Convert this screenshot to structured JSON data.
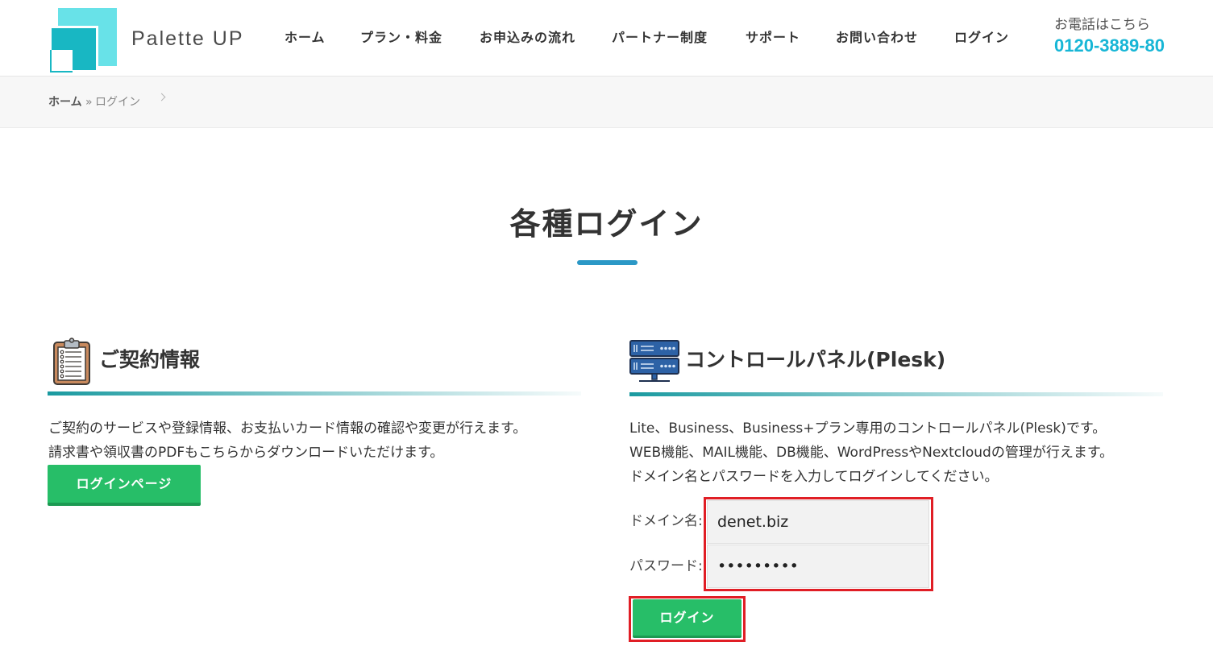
{
  "header": {
    "logo_icon": "palette-up-logo-icon",
    "logo_text": "Palette UP",
    "nav": [
      "ホーム",
      "プラン・料金",
      "お申込みの流れ",
      "パートナー制度",
      "サポート",
      "お問い合わせ",
      "ログイン"
    ],
    "phone_label": "お電話はこちら",
    "phone_number": "0120-3889-80"
  },
  "breadcrumb": {
    "home": "ホーム",
    "separator": "»",
    "current": "ログイン",
    "chevron_icon": "chevron-right-icon"
  },
  "page_title": "各種ログイン",
  "contract": {
    "icon": "clipboard-icon",
    "heading": "ご契約情報",
    "lines": [
      "ご契約のサービスや登録情報、お支払いカード情報の確認や変更が行えます。",
      "請求書や領収書のPDFもこちらからダウンロードいただけます。"
    ],
    "button": "ログインページ"
  },
  "plesk": {
    "icon": "server-icon",
    "heading": "コントロールパネル(Plesk)",
    "lines": [
      "Lite、Business、Business+プラン専用のコントロールパネル(Plesk)です。",
      "WEB機能、MAIL機能、DB機能、WordPressやNextcloudの管理が行えます。",
      "ドメイン名とパスワードを入力してログインしてください。"
    ],
    "domain_label": "ドメイン名:",
    "domain_value": "denet.biz",
    "password_label": "パスワード:",
    "password_value": "•••••••••",
    "button": "ログイン"
  },
  "colors": {
    "accent": "#17b6d6",
    "title_bar": "#2b98c6",
    "button": "#27be68",
    "button_shadow": "#1c9a52",
    "section_line": "#1a9aa0",
    "highlight": "#e01e25"
  }
}
